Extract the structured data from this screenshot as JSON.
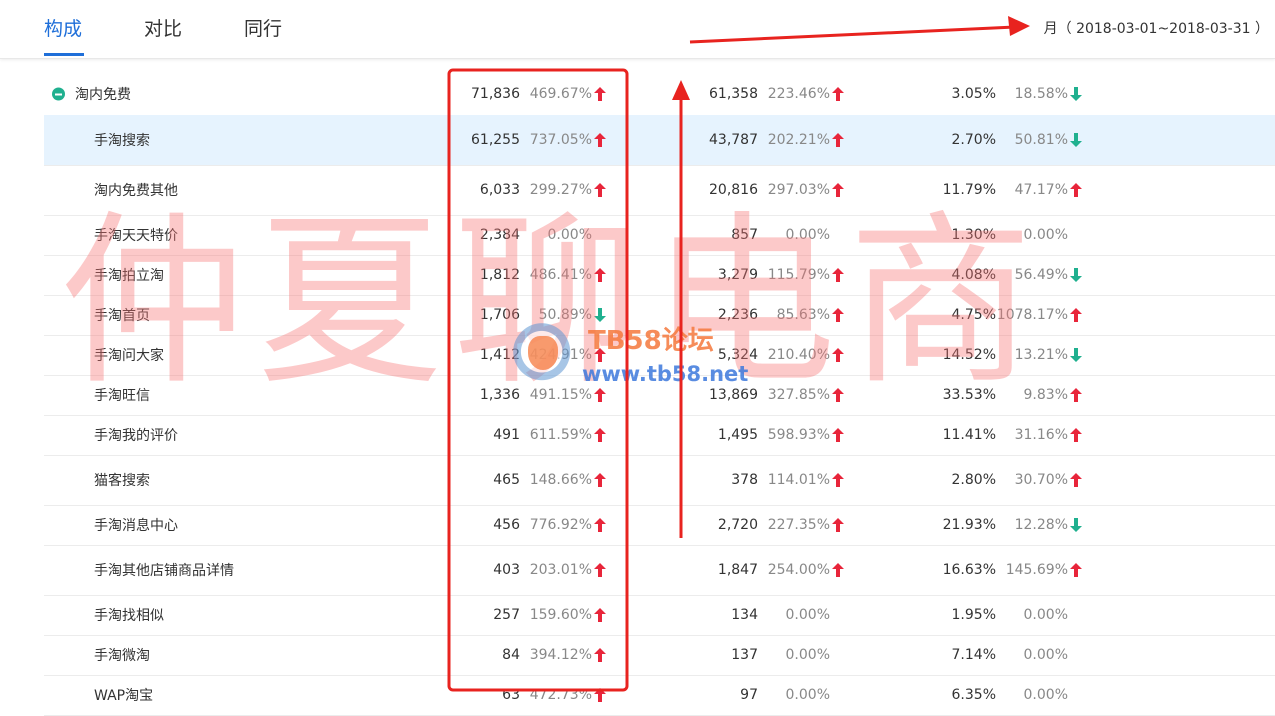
{
  "tabs": [
    "构成",
    "对比",
    "同行"
  ],
  "date_range": "月（ 2018-03-01~2018-03-31 ）",
  "watermark": "仲夏聊电商",
  "logo": {
    "title": "TB58论坛",
    "url": "www.tb58.net"
  },
  "rows": [
    {
      "name": "淘内免费",
      "c1": "71,836",
      "c2": "469.67%",
      "c2dir": "up",
      "c3": "61,358",
      "c4": "223.46%",
      "c4dir": "up",
      "c5": "3.05%",
      "c6": "18.58%",
      "c6dir": "down"
    },
    {
      "name": "手淘搜索",
      "c1": "61,255",
      "c2": "737.05%",
      "c2dir": "up",
      "c3": "43,787",
      "c4": "202.21%",
      "c4dir": "up",
      "c5": "2.70%",
      "c6": "50.81%",
      "c6dir": "down"
    },
    {
      "name": "淘内免费其他",
      "c1": "6,033",
      "c2": "299.27%",
      "c2dir": "up",
      "c3": "20,816",
      "c4": "297.03%",
      "c4dir": "up",
      "c5": "11.79%",
      "c6": "47.17%",
      "c6dir": "up"
    },
    {
      "name": "手淘天天特价",
      "c1": "2,384",
      "c2": "0.00%",
      "c2dir": "",
      "c3": "857",
      "c4": "0.00%",
      "c4dir": "",
      "c5": "1.30%",
      "c6": "0.00%",
      "c6dir": ""
    },
    {
      "name": "手淘拍立淘",
      "c1": "1,812",
      "c2": "486.41%",
      "c2dir": "up",
      "c3": "3,279",
      "c4": "115.79%",
      "c4dir": "up",
      "c5": "4.08%",
      "c6": "56.49%",
      "c6dir": "down"
    },
    {
      "name": "手淘首页",
      "c1": "1,706",
      "c2": "50.89%",
      "c2dir": "down",
      "c3": "2,236",
      "c4": "85.63%",
      "c4dir": "up",
      "c5": "4.75%",
      "c6": "1078.17%",
      "c6dir": "up"
    },
    {
      "name": "手淘问大家",
      "c1": "1,412",
      "c2": "424.91%",
      "c2dir": "up",
      "c3": "5,324",
      "c4": "210.40%",
      "c4dir": "up",
      "c5": "14.52%",
      "c6": "13.21%",
      "c6dir": "down"
    },
    {
      "name": "手淘旺信",
      "c1": "1,336",
      "c2": "491.15%",
      "c2dir": "up",
      "c3": "13,869",
      "c4": "327.85%",
      "c4dir": "up",
      "c5": "33.53%",
      "c6": "9.83%",
      "c6dir": "up"
    },
    {
      "name": "手淘我的评价",
      "c1": "491",
      "c2": "611.59%",
      "c2dir": "up",
      "c3": "1,495",
      "c4": "598.93%",
      "c4dir": "up",
      "c5": "11.41%",
      "c6": "31.16%",
      "c6dir": "up"
    },
    {
      "name": "猫客搜索",
      "c1": "465",
      "c2": "148.66%",
      "c2dir": "up",
      "c3": "378",
      "c4": "114.01%",
      "c4dir": "up",
      "c5": "2.80%",
      "c6": "30.70%",
      "c6dir": "up"
    },
    {
      "name": "手淘消息中心",
      "c1": "456",
      "c2": "776.92%",
      "c2dir": "up",
      "c3": "2,720",
      "c4": "227.35%",
      "c4dir": "up",
      "c5": "21.93%",
      "c6": "12.28%",
      "c6dir": "down"
    },
    {
      "name": "手淘其他店铺商品详情",
      "c1": "403",
      "c2": "203.01%",
      "c2dir": "up",
      "c3": "1,847",
      "c4": "254.00%",
      "c4dir": "up",
      "c5": "16.63%",
      "c6": "145.69%",
      "c6dir": "up"
    },
    {
      "name": "手淘找相似",
      "c1": "257",
      "c2": "159.60%",
      "c2dir": "up",
      "c3": "134",
      "c4": "0.00%",
      "c4dir": "",
      "c5": "1.95%",
      "c6": "0.00%",
      "c6dir": ""
    },
    {
      "name": "手淘微淘",
      "c1": "84",
      "c2": "394.12%",
      "c2dir": "up",
      "c3": "137",
      "c4": "0.00%",
      "c4dir": "",
      "c5": "7.14%",
      "c6": "0.00%",
      "c6dir": ""
    },
    {
      "name": "WAP淘宝",
      "c1": "63",
      "c2": "472.73%",
      "c2dir": "up",
      "c3": "97",
      "c4": "0.00%",
      "c4dir": "",
      "c5": "6.35%",
      "c6": "0.00%",
      "c6dir": ""
    }
  ],
  "colors": {
    "accent": "#1f6fd9",
    "up": "#e8253a",
    "down": "#1fb08f",
    "annotation": "#e8231f",
    "highlight": "#e6f3fe"
  }
}
